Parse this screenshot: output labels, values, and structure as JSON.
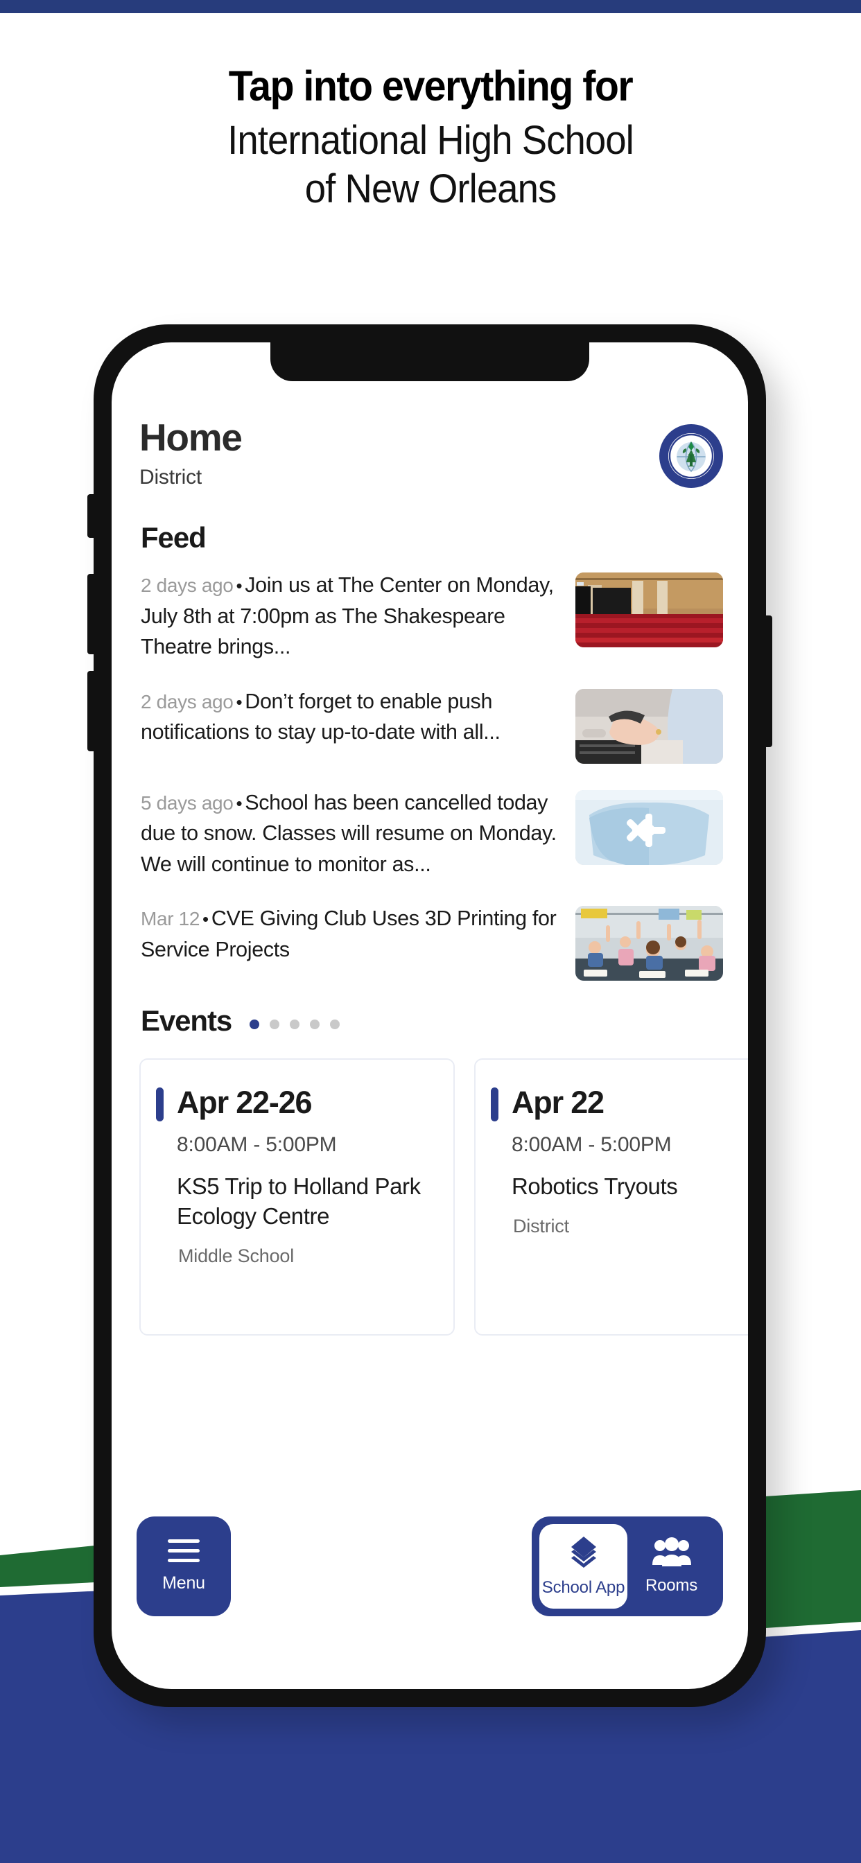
{
  "theme": {
    "brand_blue": "#2C3E8C",
    "top_bar_blue": "#273C7C",
    "accent_green": "#1F6B33",
    "muted_gray": "#9a9a9a"
  },
  "promo": {
    "line1": "Tap into everything for",
    "line2": "International High School",
    "line3": "of New Orleans"
  },
  "app": {
    "header": {
      "title": "Home",
      "subtitle": "District",
      "logo_icon": "school-crest-icon"
    },
    "feed": {
      "heading": "Feed",
      "items": [
        {
          "time": "2 days ago",
          "separator": "•",
          "text": "Join us at The Center on Monday, July 8th at 7:00pm as The Shakespeare Theatre brings...",
          "thumbnail": "auditorium-red-seats-image"
        },
        {
          "time": "2 days ago",
          "separator": "•",
          "text": "Don’t forget to enable push notifications to stay up-to-date with all...",
          "thumbnail": "hands-phone-laptop-image"
        },
        {
          "time": "5 days ago",
          "separator": "•",
          "text": "School has been cancelled today due to snow. Classes will resume on Monday. We will continue to monitor as...",
          "thumbnail": "mittens-snowflake-image"
        },
        {
          "time": "Mar 12",
          "separator": "•",
          "text": "CVE Giving Club Uses 3D Printing for Service Projects",
          "thumbnail": "classroom-students-image"
        }
      ]
    },
    "events": {
      "heading": "Events",
      "pagination": {
        "total": 5,
        "active_index": 0
      },
      "cards": [
        {
          "date": "Apr 22-26",
          "time": "8:00AM  -  5:00PM",
          "name": "KS5 Trip to Holland Park Ecology Centre",
          "scope": "Middle School"
        },
        {
          "date": "Apr 22",
          "time": "8:00AM  -  5:00PM",
          "name": "Robotics Tryouts",
          "scope": "District"
        }
      ]
    },
    "nav": {
      "menu": {
        "label": "Menu",
        "icon": "hamburger-icon"
      },
      "tiles": [
        {
          "label": "School App",
          "icon": "layers-diamond-icon",
          "active": true
        },
        {
          "label": "Rooms",
          "icon": "people-group-icon",
          "active": false
        }
      ]
    }
  }
}
